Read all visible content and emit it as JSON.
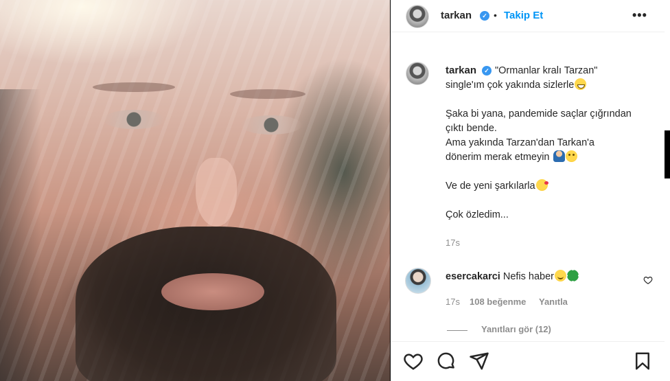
{
  "post": {
    "username": "tarkan",
    "verified_mark": "✓",
    "dot": "•",
    "follow_label": "Takip Et",
    "more_label": "•••",
    "caption": {
      "line1": "\"Ormanlar kralı Tarzan\"",
      "line2": "single'ım çok yakında sizlerle",
      "line3": "Şaka bi yana, pandemide saçlar çığrından",
      "line4": "çıktı bende.",
      "line5": "Ama yakında Tarzan'dan Tarkan'a",
      "line6": "dönerim merak etmeyin",
      "line7": "Ve de yeni şarkılarla",
      "line8": "Çok özledim..."
    },
    "timestamp": "17s"
  },
  "comment": {
    "username": "esercakarci",
    "text": "Nefis haber",
    "time": "17s",
    "likes": "108 beğenme",
    "reply_label": "Yanıtla",
    "view_replies": "Yanıtları gör (12)"
  },
  "icons": {
    "like": "heart-icon",
    "comment": "comment-icon",
    "share": "share-icon",
    "save": "bookmark-icon"
  },
  "colors": {
    "accent": "#0095f6",
    "verified": "#3897f0",
    "muted": "#8e8e8e",
    "text": "#262626"
  }
}
